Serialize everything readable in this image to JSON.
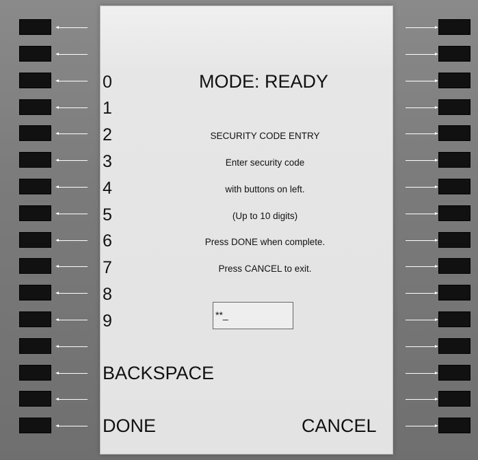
{
  "screen": {
    "mode_title": "MODE: READY",
    "digits": [
      "0",
      "1",
      "2",
      "3",
      "4",
      "5",
      "6",
      "7",
      "8",
      "9"
    ],
    "heading": "SECURITY CODE ENTRY",
    "instructions": [
      "Enter security code",
      "with buttons on left.",
      "(Up to 10 digits)",
      "Press DONE when complete.",
      "Press CANCEL to exit."
    ],
    "code_value": "**_",
    "backspace_label": "BACKSPACE",
    "done_label": "DONE",
    "cancel_label": "CANCEL"
  },
  "colors": {
    "bezel": "#7d7d7d",
    "screen": "#e3e3e3",
    "key": "#111111",
    "leader": "#ffffff"
  }
}
